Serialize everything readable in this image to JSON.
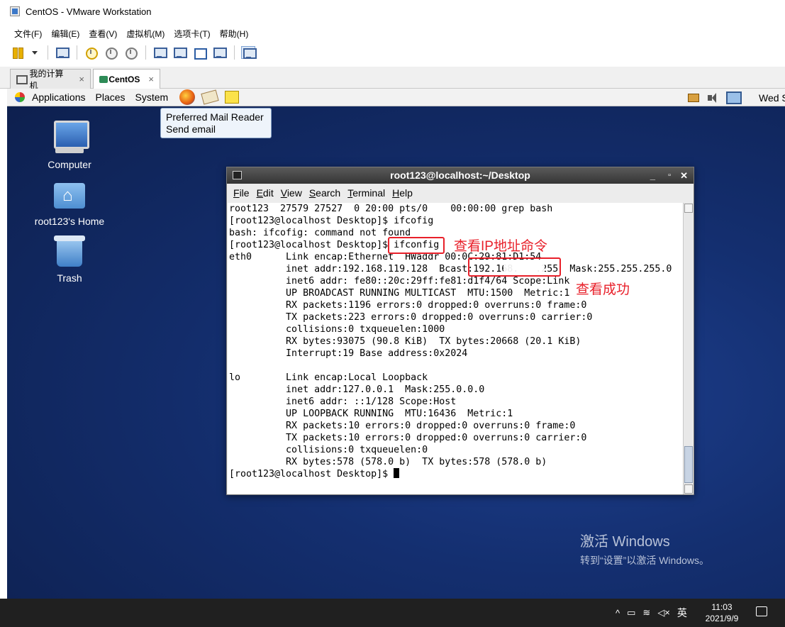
{
  "window": {
    "title": "CentOS - VMware Workstation"
  },
  "menubar": [
    "文件(F)",
    "编辑(E)",
    "查看(V)",
    "虚拟机(M)",
    "选项卡(T)",
    "帮助(H)"
  ],
  "tabs": [
    {
      "label": "我的计算机",
      "close": "×"
    },
    {
      "label": "CentOS",
      "close": "×"
    }
  ],
  "guest_panel": {
    "menus": [
      "Applications",
      "Places",
      "System"
    ],
    "clock": "Wed S"
  },
  "tooltip": {
    "line1": "Preferred Mail Reader",
    "line2": "Send email"
  },
  "desktop_icons": [
    "Computer",
    "root123's Home",
    "Trash"
  ],
  "terminal": {
    "title": "root123@localhost:~/Desktop",
    "menu": [
      "File",
      "Edit",
      "View",
      "Search",
      "Terminal",
      "Help"
    ],
    "output": "root123  27579 27527  0 20:00 pts/0    00:00:00 grep bash\n[root123@localhost Desktop]$ ifcofig\nbash: ifcofig: command not found\n[root123@localhost Desktop]$ ifconfig\neth0      Link encap:Ethernet  HWaddr 00:0C:29:81:D1:54\n          inet addr:192.168.119.128  Bcast:192.168.   .255  Mask:255.255.255.0\n          inet6 addr: fe80::20c:29ff:fe81:d1f4/64 Scope:Link\n          UP BROADCAST RUNNING MULTICAST  MTU:1500  Metric:1\n          RX packets:1196 errors:0 dropped:0 overruns:0 frame:0\n          TX packets:223 errors:0 dropped:0 overruns:0 carrier:0\n          collisions:0 txqueuelen:1000\n          RX bytes:93075 (90.8 KiB)  TX bytes:20668 (20.1 KiB)\n          Interrupt:19 Base address:0x2024\n\nlo        Link encap:Local Loopback\n          inet addr:127.0.0.1  Mask:255.0.0.0\n          inet6 addr: ::1/128 Scope:Host\n          UP LOOPBACK RUNNING  MTU:16436  Metric:1\n          RX packets:10 errors:0 dropped:0 overruns:0 frame:0\n          TX packets:10 errors:0 dropped:0 overruns:0 carrier:0\n          collisions:0 txqueuelen:0\n          RX bytes:578 (578.0 b)  TX bytes:578 (578.0 b)\n",
    "prompt": "[root123@localhost Desktop]$ "
  },
  "annotations": {
    "cmd": "查看IP地址命令",
    "success": "查看成功"
  },
  "watermark": {
    "line1": "激活 Windows",
    "line2": "转到“设置”以激活 Windows。"
  },
  "taskbar": {
    "time": "11:03",
    "date": "2021/9/9",
    "ime": "英"
  }
}
